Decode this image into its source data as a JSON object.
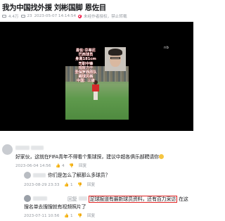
{
  "video": {
    "title": "我为中国找外援 刘彬国脚 恩佐目",
    "meta": {
      "views": "4.4万",
      "danmaku": "23",
      "datetime": "2023-05-07 14:14:54",
      "notice": "未经作者授权，禁止转载"
    },
    "overlay_text": "恩佐·芬蒂尼\n巴西球员\n身高181cm\n司职中锋\n现效力于\n圣保罗西原队\n踢球风格\n中国：三级\n",
    "watermark": "nb"
  },
  "comments": [
    {
      "text": "好家伙，这就在FIFA青年不得看个集球探，建议中超各俱乐部聘请你",
      "time": "2023-06-04 14:56",
      "likes": "4"
    },
    {
      "reply_text": "你们是怎么了解那么多球员？",
      "time": "2023-08-29 23:33",
      "likes": "1"
    },
    {
      "name_label": "回复",
      "highlighted_text": "足球报道有最新球员资料，还有百力采访",
      "tail_text": "在这",
      "continuation": "搜名单去搜搜就有视频照片了",
      "time": "2023-07-11 10:56",
      "likes": "1"
    }
  ]
}
